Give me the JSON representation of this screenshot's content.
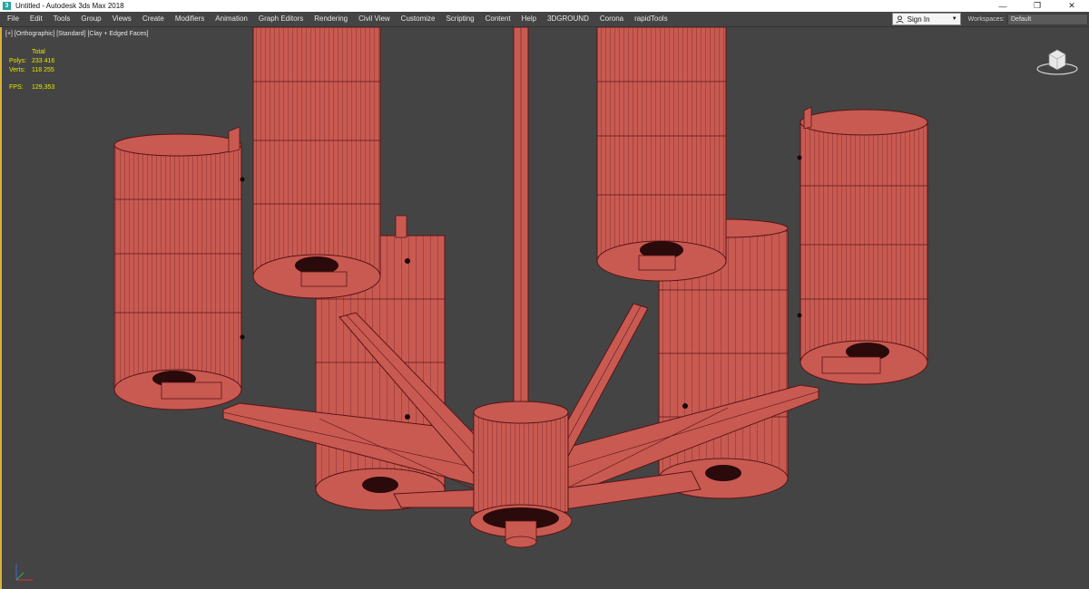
{
  "window": {
    "title": "Untitled - Autodesk 3ds Max 2018",
    "app_icon_glyph": "3",
    "minimize_glyph": "—",
    "restore_glyph": "❐",
    "close_glyph": "✕"
  },
  "menu": {
    "items": [
      "File",
      "Edit",
      "Tools",
      "Group",
      "Views",
      "Create",
      "Modifiers",
      "Animation",
      "Graph Editors",
      "Rendering",
      "Civil View",
      "Customize",
      "Scripting",
      "Content",
      "Help",
      "3DGROUND",
      "Corona",
      "rapidTools"
    ],
    "signin_label": "Sign In",
    "workspaces_label": "Workspaces:",
    "workspaces_value": "Default"
  },
  "viewport": {
    "label": "[+] [Orthographic] [Standard] [Clay + Edged Faces]",
    "stats": {
      "header": "Total",
      "polys_label": "Polys:",
      "polys_value": "233 416",
      "verts_label": "Verts:",
      "verts_value": "118 255",
      "fps_label": "FPS:",
      "fps_value": "129,353"
    }
  },
  "colors": {
    "model_fill": "#c85a52",
    "model_wire": "#5a1414",
    "viewport_bg": "#444444",
    "active_border": "#d8b23a",
    "stats_text": "#e8e600"
  },
  "icons": {
    "app": "3ds-max-icon",
    "signin": "user-icon",
    "viewcube": "viewcube-icon",
    "axis": "axis-tripod-icon"
  }
}
